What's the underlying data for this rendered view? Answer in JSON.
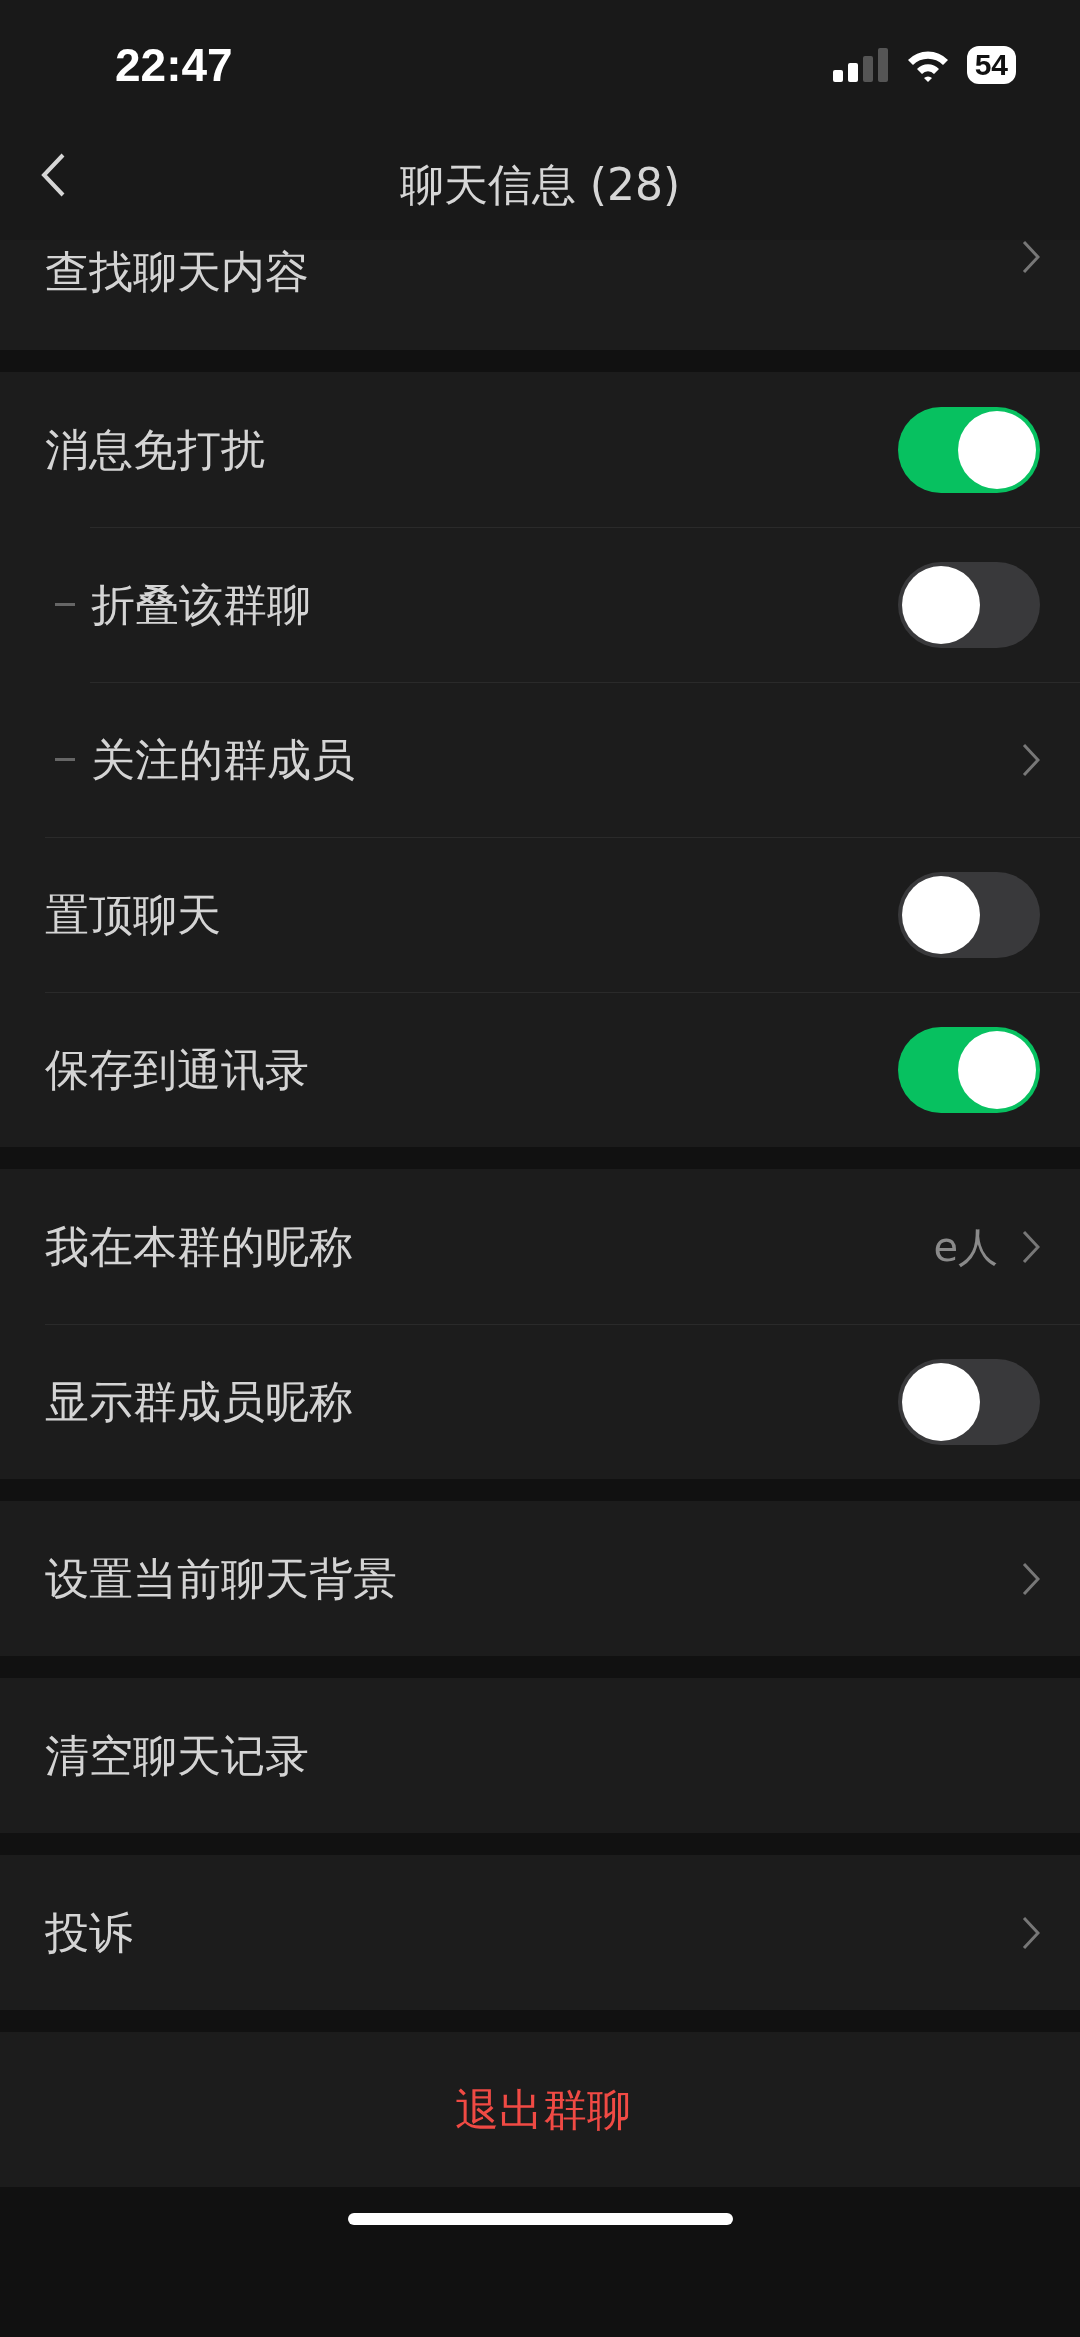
{
  "status_bar": {
    "time": "22:47",
    "battery": "54"
  },
  "nav": {
    "title": "聊天信息 (28)"
  },
  "groups": [
    {
      "items": [
        {
          "kind": "link",
          "label": "查找聊天内容",
          "partial": true
        }
      ]
    },
    {
      "items": [
        {
          "kind": "toggle",
          "label": "消息免打扰",
          "on": true,
          "children": [
            {
              "kind": "toggle",
              "label": "折叠该群聊",
              "on": false
            },
            {
              "kind": "link",
              "label": "关注的群成员"
            }
          ]
        },
        {
          "kind": "toggle",
          "label": "置顶聊天",
          "on": false
        },
        {
          "kind": "toggle",
          "label": "保存到通讯录",
          "on": true
        }
      ]
    },
    {
      "items": [
        {
          "kind": "link",
          "label": "我在本群的昵称",
          "value": "e人"
        },
        {
          "kind": "toggle",
          "label": "显示群成员昵称",
          "on": false
        }
      ]
    },
    {
      "items": [
        {
          "kind": "link",
          "label": "设置当前聊天背景"
        }
      ]
    },
    {
      "items": [
        {
          "kind": "action",
          "label": "清空聊天记录"
        }
      ]
    },
    {
      "items": [
        {
          "kind": "link",
          "label": "投诉"
        }
      ]
    },
    {
      "items": [
        {
          "kind": "danger",
          "label": "退出群聊"
        }
      ]
    }
  ]
}
